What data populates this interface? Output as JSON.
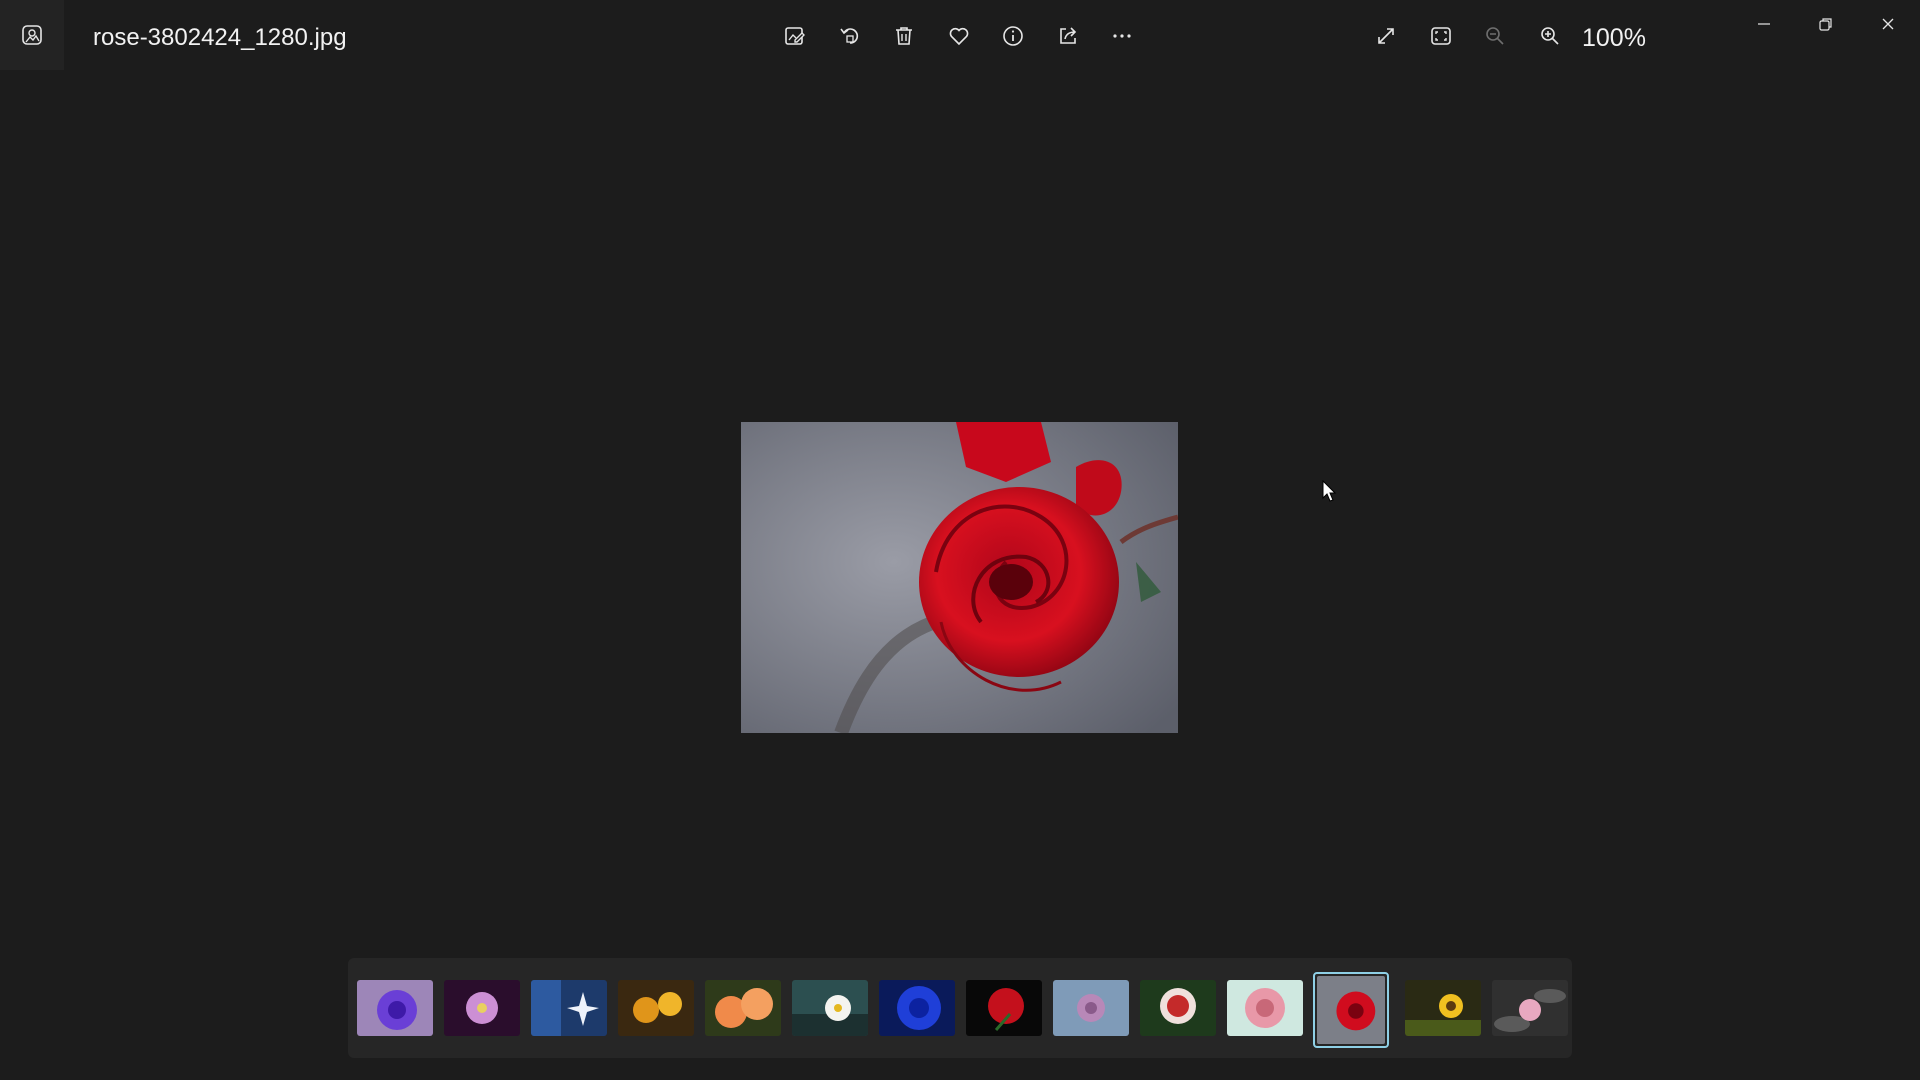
{
  "window": {
    "file_name": "rose-3802424_1280.jpg",
    "zoom_label": "100%"
  },
  "toolbar": {
    "items": [
      {
        "name": "edit-image",
        "icon": "edit-image-icon"
      },
      {
        "name": "rotate",
        "icon": "rotate-icon"
      },
      {
        "name": "delete",
        "icon": "trash-icon"
      },
      {
        "name": "favorite",
        "icon": "heart-icon"
      },
      {
        "name": "file-info",
        "icon": "info-icon"
      },
      {
        "name": "share",
        "icon": "share-icon"
      },
      {
        "name": "see-more",
        "icon": "more-icon"
      }
    ]
  },
  "view_controls": [
    {
      "name": "fullscreen",
      "icon": "expand-icon"
    },
    {
      "name": "fit-to-window",
      "icon": "fit-window-icon"
    },
    {
      "name": "zoom-out",
      "icon": "zoom-out-icon",
      "enabled": false
    },
    {
      "name": "zoom-in",
      "icon": "zoom-in-icon",
      "enabled": true
    }
  ],
  "window_controls": [
    "minimize-icon",
    "restore-icon",
    "close-icon"
  ],
  "filmstrip": {
    "selected_index": 11,
    "thumbnails": [
      {
        "subject": "purple chrysanthemum"
      },
      {
        "subject": "pink daisy on dark purple"
      },
      {
        "subject": "white star flower on blue"
      },
      {
        "subject": "yellow orange flowers"
      },
      {
        "subject": "orange peach roses"
      },
      {
        "subject": "white daisy on teal"
      },
      {
        "subject": "blue rose"
      },
      {
        "subject": "red rose on black"
      },
      {
        "subject": "lilac rose"
      },
      {
        "subject": "red white rose"
      },
      {
        "subject": "pink rose"
      },
      {
        "subject": "red rose"
      },
      {
        "subject": "sunflower"
      },
      {
        "subject": "pink water lily"
      }
    ]
  },
  "colors": {
    "background": "#1c1c1c",
    "filmstrip_bg": "#262626",
    "selection_border": "#8fd0e6",
    "icon": "#e6e6e6"
  }
}
